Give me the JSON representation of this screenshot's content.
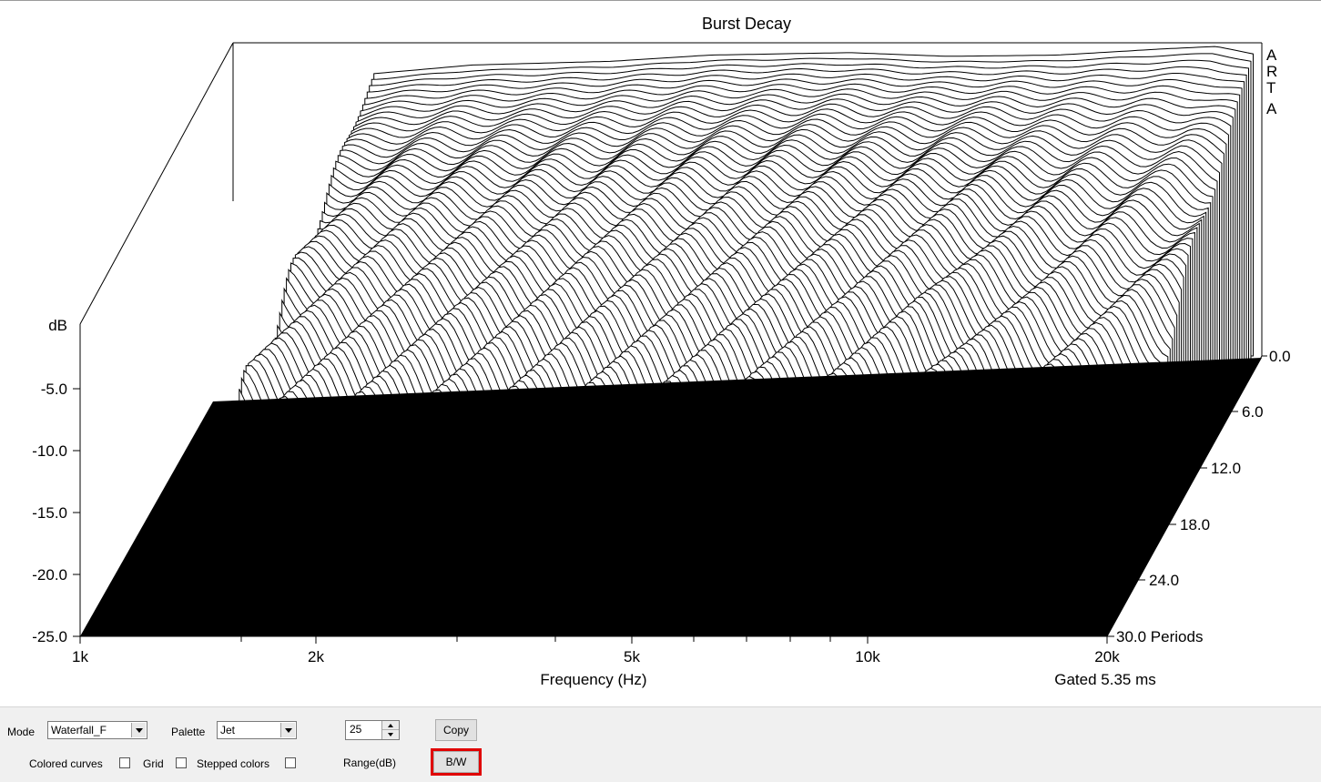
{
  "chart": {
    "title": "Burst Decay",
    "logo": [
      "A",
      "R",
      "T",
      "A"
    ],
    "y_axis_label": "dB",
    "x_axis_label": "Frequency (Hz)",
    "gated_label": "Gated 5.35 ms",
    "y_ticks": [
      "-5.0",
      "-10.0",
      "-15.0",
      "-20.0",
      "-25.0"
    ],
    "x_ticks": [
      "1k",
      "2k",
      "5k",
      "10k",
      "20k"
    ],
    "z_ticks": [
      "0.0",
      "6.0",
      "12.0",
      "18.0",
      "24.0",
      "30.0 Periods"
    ]
  },
  "chart_data": {
    "type": "area",
    "title": "Burst Decay",
    "xlabel": "Frequency (Hz)",
    "ylabel": "dB",
    "zlabel": "Periods",
    "x_scale": "log",
    "xlim": [
      1000,
      20000
    ],
    "ylim": [
      -25,
      0
    ],
    "zlim": [
      0,
      30
    ],
    "x_ticks": [
      "1k",
      "2k",
      "5k",
      "10k",
      "20k"
    ],
    "y_ticks": [
      -5,
      -10,
      -15,
      -20,
      -25
    ],
    "z_ticks": [
      0,
      6,
      12,
      18,
      24,
      30
    ],
    "front_slice": {
      "x": [
        1500,
        2000,
        3000,
        4000,
        6000,
        8000,
        11000,
        15000,
        17500,
        19500
      ],
      "y": [
        -2.2,
        -1.5,
        -1.2,
        -0.7,
        -0.5,
        -0.8,
        -0.7,
        -0.2,
        0.0,
        -0.6
      ]
    }
  },
  "controls": {
    "mode_label": "Mode",
    "mode_value": "Waterfall_F",
    "palette_label": "Palette",
    "palette_value": "Jet",
    "range_value": "25",
    "range_label": "Range(dB)",
    "colored_curves_label": "Colored curves",
    "grid_label": "Grid",
    "stepped_colors_label": "Stepped colors",
    "copy_label": "Copy",
    "bw_label": "B/W"
  }
}
